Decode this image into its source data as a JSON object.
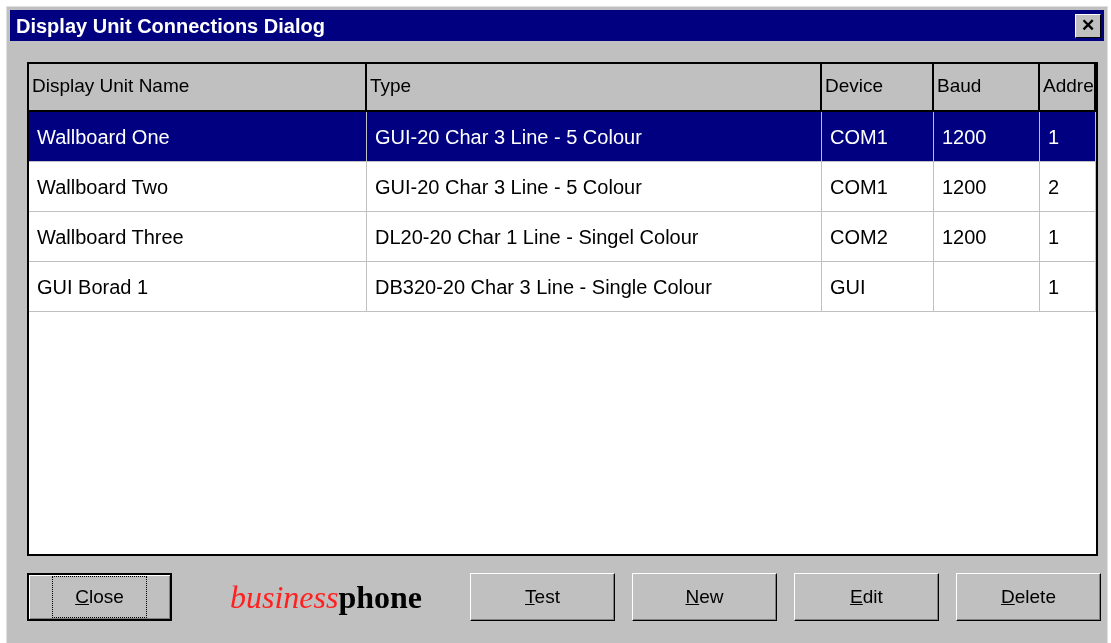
{
  "window": {
    "title": "Display Unit Connections Dialog",
    "close_glyph": "✕"
  },
  "table": {
    "columns": [
      "Display Unit Name",
      "Type",
      "Device",
      "Baud",
      "Addre"
    ],
    "rows": [
      {
        "selected": true,
        "cells": [
          "Wallboard One",
          "GUI-20 Char 3 Line - 5 Colour",
          "COM1",
          "1200",
          "1"
        ]
      },
      {
        "selected": false,
        "cells": [
          "Wallboard Two",
          "GUI-20 Char 3 Line - 5 Colour",
          "COM1",
          "1200",
          "2"
        ]
      },
      {
        "selected": false,
        "cells": [
          "Wallboard Three",
          "DL20-20 Char 1 Line - Singel Colour",
          "COM2",
          "1200",
          "1"
        ]
      },
      {
        "selected": false,
        "cells": [
          "GUI Borad 1",
          "DB320-20 Char 3 Line - Single Colour",
          "GUI",
          "",
          "1"
        ]
      }
    ]
  },
  "buttons_left": [
    {
      "key": "C",
      "rest": "lose",
      "default": true
    }
  ],
  "logo": {
    "part_1": "business",
    "part_2": "phone"
  },
  "buttons_right": [
    {
      "key": "T",
      "rest": "est",
      "default": false
    },
    {
      "key": "N",
      "rest": "ew",
      "default": false
    },
    {
      "key": "E",
      "rest": "dit",
      "default": false
    },
    {
      "key": "D",
      "rest": "elete",
      "default": false
    }
  ]
}
